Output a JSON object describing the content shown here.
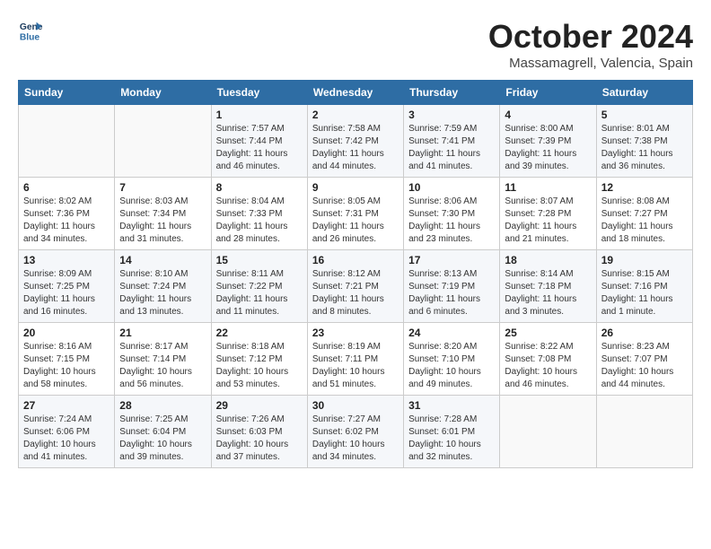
{
  "header": {
    "logo_line1": "General",
    "logo_line2": "Blue",
    "month_title": "October 2024",
    "location": "Massamagrell, Valencia, Spain"
  },
  "days_of_week": [
    "Sunday",
    "Monday",
    "Tuesday",
    "Wednesday",
    "Thursday",
    "Friday",
    "Saturday"
  ],
  "weeks": [
    [
      {
        "day": "",
        "info": ""
      },
      {
        "day": "",
        "info": ""
      },
      {
        "day": "1",
        "info": "Sunrise: 7:57 AM\nSunset: 7:44 PM\nDaylight: 11 hours and 46 minutes."
      },
      {
        "day": "2",
        "info": "Sunrise: 7:58 AM\nSunset: 7:42 PM\nDaylight: 11 hours and 44 minutes."
      },
      {
        "day": "3",
        "info": "Sunrise: 7:59 AM\nSunset: 7:41 PM\nDaylight: 11 hours and 41 minutes."
      },
      {
        "day": "4",
        "info": "Sunrise: 8:00 AM\nSunset: 7:39 PM\nDaylight: 11 hours and 39 minutes."
      },
      {
        "day": "5",
        "info": "Sunrise: 8:01 AM\nSunset: 7:38 PM\nDaylight: 11 hours and 36 minutes."
      }
    ],
    [
      {
        "day": "6",
        "info": "Sunrise: 8:02 AM\nSunset: 7:36 PM\nDaylight: 11 hours and 34 minutes."
      },
      {
        "day": "7",
        "info": "Sunrise: 8:03 AM\nSunset: 7:34 PM\nDaylight: 11 hours and 31 minutes."
      },
      {
        "day": "8",
        "info": "Sunrise: 8:04 AM\nSunset: 7:33 PM\nDaylight: 11 hours and 28 minutes."
      },
      {
        "day": "9",
        "info": "Sunrise: 8:05 AM\nSunset: 7:31 PM\nDaylight: 11 hours and 26 minutes."
      },
      {
        "day": "10",
        "info": "Sunrise: 8:06 AM\nSunset: 7:30 PM\nDaylight: 11 hours and 23 minutes."
      },
      {
        "day": "11",
        "info": "Sunrise: 8:07 AM\nSunset: 7:28 PM\nDaylight: 11 hours and 21 minutes."
      },
      {
        "day": "12",
        "info": "Sunrise: 8:08 AM\nSunset: 7:27 PM\nDaylight: 11 hours and 18 minutes."
      }
    ],
    [
      {
        "day": "13",
        "info": "Sunrise: 8:09 AM\nSunset: 7:25 PM\nDaylight: 11 hours and 16 minutes."
      },
      {
        "day": "14",
        "info": "Sunrise: 8:10 AM\nSunset: 7:24 PM\nDaylight: 11 hours and 13 minutes."
      },
      {
        "day": "15",
        "info": "Sunrise: 8:11 AM\nSunset: 7:22 PM\nDaylight: 11 hours and 11 minutes."
      },
      {
        "day": "16",
        "info": "Sunrise: 8:12 AM\nSunset: 7:21 PM\nDaylight: 11 hours and 8 minutes."
      },
      {
        "day": "17",
        "info": "Sunrise: 8:13 AM\nSunset: 7:19 PM\nDaylight: 11 hours and 6 minutes."
      },
      {
        "day": "18",
        "info": "Sunrise: 8:14 AM\nSunset: 7:18 PM\nDaylight: 11 hours and 3 minutes."
      },
      {
        "day": "19",
        "info": "Sunrise: 8:15 AM\nSunset: 7:16 PM\nDaylight: 11 hours and 1 minute."
      }
    ],
    [
      {
        "day": "20",
        "info": "Sunrise: 8:16 AM\nSunset: 7:15 PM\nDaylight: 10 hours and 58 minutes."
      },
      {
        "day": "21",
        "info": "Sunrise: 8:17 AM\nSunset: 7:14 PM\nDaylight: 10 hours and 56 minutes."
      },
      {
        "day": "22",
        "info": "Sunrise: 8:18 AM\nSunset: 7:12 PM\nDaylight: 10 hours and 53 minutes."
      },
      {
        "day": "23",
        "info": "Sunrise: 8:19 AM\nSunset: 7:11 PM\nDaylight: 10 hours and 51 minutes."
      },
      {
        "day": "24",
        "info": "Sunrise: 8:20 AM\nSunset: 7:10 PM\nDaylight: 10 hours and 49 minutes."
      },
      {
        "day": "25",
        "info": "Sunrise: 8:22 AM\nSunset: 7:08 PM\nDaylight: 10 hours and 46 minutes."
      },
      {
        "day": "26",
        "info": "Sunrise: 8:23 AM\nSunset: 7:07 PM\nDaylight: 10 hours and 44 minutes."
      }
    ],
    [
      {
        "day": "27",
        "info": "Sunrise: 7:24 AM\nSunset: 6:06 PM\nDaylight: 10 hours and 41 minutes."
      },
      {
        "day": "28",
        "info": "Sunrise: 7:25 AM\nSunset: 6:04 PM\nDaylight: 10 hours and 39 minutes."
      },
      {
        "day": "29",
        "info": "Sunrise: 7:26 AM\nSunset: 6:03 PM\nDaylight: 10 hours and 37 minutes."
      },
      {
        "day": "30",
        "info": "Sunrise: 7:27 AM\nSunset: 6:02 PM\nDaylight: 10 hours and 34 minutes."
      },
      {
        "day": "31",
        "info": "Sunrise: 7:28 AM\nSunset: 6:01 PM\nDaylight: 10 hours and 32 minutes."
      },
      {
        "day": "",
        "info": ""
      },
      {
        "day": "",
        "info": ""
      }
    ]
  ]
}
